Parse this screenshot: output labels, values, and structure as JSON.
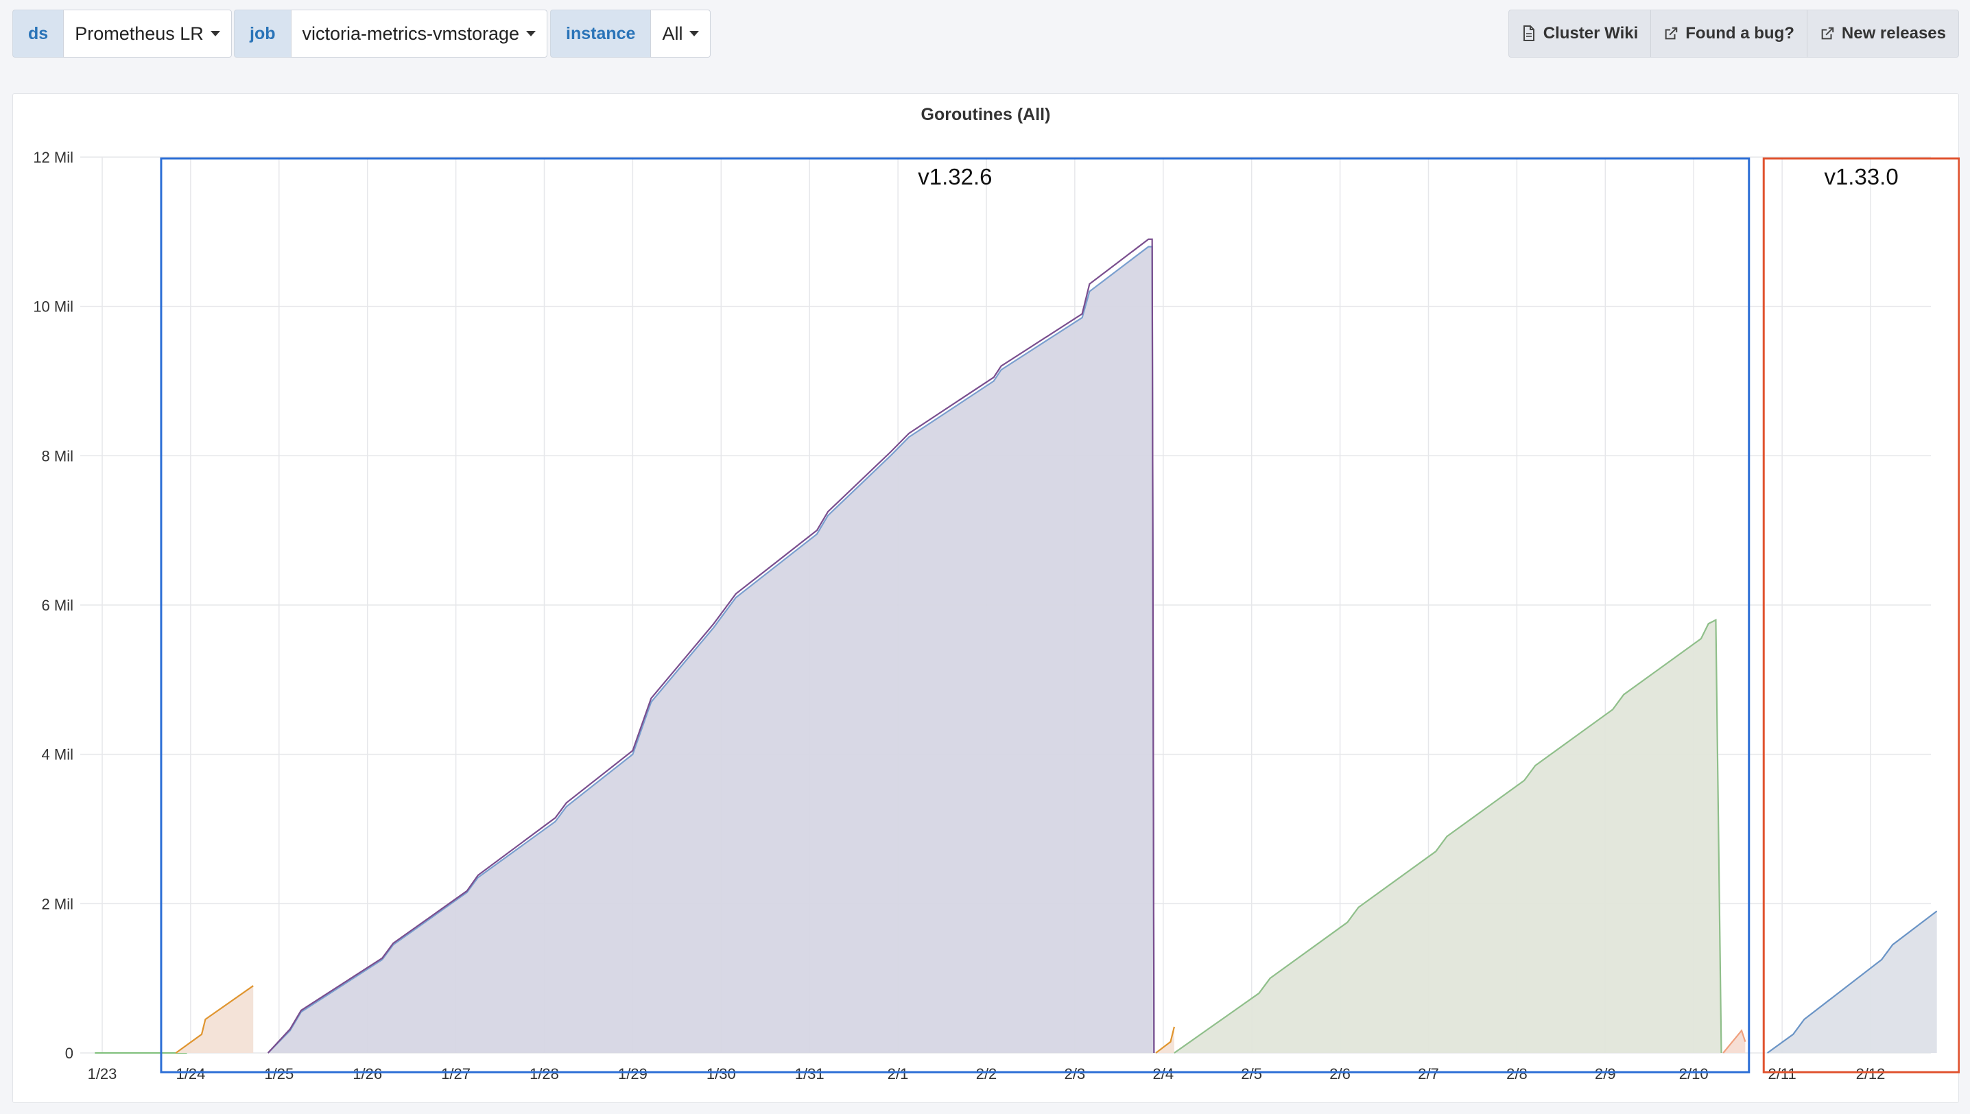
{
  "variables": [
    {
      "label": "ds",
      "value": "Prometheus LR"
    },
    {
      "label": "job",
      "value": "victoria-metrics-vmstorage"
    },
    {
      "label": "instance",
      "value": "All"
    }
  ],
  "links": [
    {
      "label": "Cluster Wiki",
      "icon": "document-icon"
    },
    {
      "label": "Found a bug?",
      "icon": "external-link-icon"
    },
    {
      "label": "New releases",
      "icon": "external-link-icon"
    }
  ],
  "panel": {
    "title": "Goroutines (All)"
  },
  "colors": {
    "series_blue": "#6f8fc6",
    "series_purple": "#7a4e8e",
    "series_orange": "#e0952f",
    "series_green": "#8fbf8a",
    "series_salmon": "#f0a07e",
    "series_slate": "#6a94c6",
    "box_v1326": "#2d6fd6",
    "box_v1330": "#e0532f"
  },
  "chart_data": {
    "type": "area",
    "title": "Goroutines (All)",
    "xlabel": "",
    "ylabel": "",
    "ylim": [
      0,
      12000000
    ],
    "yticks": [
      0,
      2000000,
      4000000,
      6000000,
      8000000,
      10000000,
      12000000
    ],
    "yticklabels": [
      "0",
      "2 Mil",
      "4 Mil",
      "6 Mil",
      "8 Mil",
      "10 Mil",
      "12 Mil"
    ],
    "xlim": [
      "01-22",
      "02-12"
    ],
    "xticks": [
      "01-23",
      "01-24",
      "01-25",
      "01-26",
      "01-27",
      "01-28",
      "01-29",
      "01-30",
      "01-31",
      "02-01",
      "02-02",
      "02-03",
      "02-04",
      "02-05",
      "02-06",
      "02-07",
      "02-08",
      "02-09",
      "02-10",
      "02-11",
      "02-12"
    ],
    "xticklabels": [
      "1/23",
      "1/24",
      "1/25",
      "1/26",
      "1/27",
      "1/28",
      "1/29",
      "1/30",
      "1/31",
      "2/1",
      "2/2",
      "2/3",
      "2/4",
      "2/5",
      "2/6",
      "2/7",
      "2/8",
      "2/9",
      "2/10",
      "2/11",
      "2/12"
    ],
    "grid": true,
    "legend": "none",
    "series": [
      {
        "color": "#7a9fcf",
        "fill": "#d6d6e4",
        "x": [
          "01-24 21:00",
          "01-25 03:00",
          "01-25 06:00",
          "01-26 04:00",
          "01-26 07:00",
          "01-27 03:00",
          "01-27 06:00",
          "01-28 03:00",
          "01-28 06:00",
          "01-29 00:00",
          "01-29 05:00",
          "01-29 22:00",
          "01-30 04:00",
          "01-31 02:00",
          "01-31 05:00",
          "01-31 22:00",
          "02-01 03:00",
          "02-02 02:00",
          "02-02 04:00",
          "02-03 02:00",
          "02-03 04:00",
          "02-03 20:00",
          "02-03 21:00",
          "02-03 21:30"
        ],
        "y": [
          0,
          300000,
          550000,
          1250000,
          1450000,
          2150000,
          2350000,
          3100000,
          3300000,
          4000000,
          4700000,
          5700000,
          6100000,
          6950000,
          7200000,
          8000000,
          8250000,
          9000000,
          9150000,
          9850000,
          10200000,
          10800000,
          10800000,
          0
        ]
      },
      {
        "color": "#7a4e8e",
        "fill": "none",
        "x": [
          "01-24 21:00",
          "01-25 03:00",
          "01-25 06:00",
          "01-26 04:00",
          "01-26 07:00",
          "01-27 03:00",
          "01-27 06:00",
          "01-28 03:00",
          "01-28 06:00",
          "01-29 00:00",
          "01-29 05:00",
          "01-29 22:00",
          "01-30 04:00",
          "01-31 02:00",
          "01-31 05:00",
          "01-31 22:00",
          "02-01 03:00",
          "02-02 02:00",
          "02-02 04:00",
          "02-03 02:00",
          "02-03 04:00",
          "02-03 20:00",
          "02-03 21:00",
          "02-03 21:30"
        ],
        "y": [
          0,
          320000,
          570000,
          1270000,
          1470000,
          2170000,
          2380000,
          3150000,
          3350000,
          4050000,
          4750000,
          5750000,
          6150000,
          7000000,
          7250000,
          8050000,
          8300000,
          9050000,
          9200000,
          9900000,
          10300000,
          10900000,
          10900000,
          0
        ]
      },
      {
        "color": "#e0952f",
        "fill": "#f3e2d6",
        "x": [
          "01-23 20:00",
          "01-24 03:00",
          "01-24 04:00",
          "01-24 17:00"
        ],
        "y": [
          0,
          250000,
          450000,
          900000
        ]
      },
      {
        "color": "#e0952f",
        "fill": "#f3e2d6",
        "x": [
          "02-03 22:00",
          "02-04 02:00",
          "02-04 03:00"
        ],
        "y": [
          0,
          150000,
          350000
        ]
      },
      {
        "color": "#8fbf8a",
        "fill": "#e2e6da",
        "x": [
          "02-04 03:00",
          "02-05 02:00",
          "02-05 05:00",
          "02-06 02:00",
          "02-06 05:00",
          "02-07 02:00",
          "02-07 05:00",
          "02-08 02:00",
          "02-08 05:00",
          "02-09 02:00",
          "02-09 05:00",
          "02-10 02:00",
          "02-10 04:00",
          "02-10 06:00",
          "02-10 07:30"
        ],
        "y": [
          0,
          800000,
          1000000,
          1750000,
          1950000,
          2700000,
          2900000,
          3650000,
          3850000,
          4600000,
          4800000,
          5550000,
          5750000,
          5800000,
          0
        ]
      },
      {
        "color": "#f0a07e",
        "fill": "#f6dcd2",
        "x": [
          "02-10 08:00",
          "02-10 13:00",
          "02-10 14:00"
        ],
        "y": [
          0,
          300000,
          150000
        ]
      },
      {
        "color": "#6a94c6",
        "fill": "#dde0e8",
        "x": [
          "02-10 20:00",
          "02-11 03:00",
          "02-11 06:00",
          "02-12 03:00",
          "02-12 06:00",
          "02-12 18:00"
        ],
        "y": [
          0,
          250000,
          450000,
          1250000,
          1450000,
          1900000
        ]
      }
    ],
    "annotations": [
      {
        "label": "v1.32.6",
        "color": "#2d6fd6",
        "x_from": "01-23 16:00",
        "x_to": "02-10 15:00"
      },
      {
        "label": "v1.33.0",
        "color": "#e0532f",
        "x_from": "02-10 19:00",
        "x_to": "02-13 00:00"
      }
    ]
  }
}
